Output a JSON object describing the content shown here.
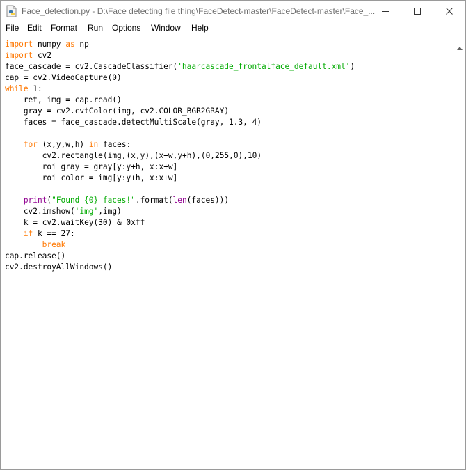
{
  "window": {
    "title": "Face_detection.py - D:\\Face detecting file thing\\FaceDetect-master\\FaceDetect-master\\Face_...",
    "app_icon": "python-file-icon",
    "controls": {
      "minimize": "minimize-icon",
      "maximize": "maximize-icon",
      "close": "close-icon"
    }
  },
  "menubar": {
    "items": [
      "File",
      "Edit",
      "Format",
      "Run",
      "Options",
      "Window",
      "Help"
    ]
  },
  "editor": {
    "language": "python",
    "colors": {
      "keyword": "#ff7700",
      "builtin": "#900090",
      "string": "#00aa00",
      "default": "#000000"
    },
    "lines": [
      "import numpy as np",
      "import cv2",
      "face_cascade = cv2.CascadeClassifier('haarcascade_frontalface_default.xml')",
      "cap = cv2.VideoCapture(0)",
      "while 1:",
      "    ret, img = cap.read()",
      "    gray = cv2.cvtColor(img, cv2.COLOR_BGR2GRAY)",
      "    faces = face_cascade.detectMultiScale(gray, 1.3, 4)",
      "",
      "    for (x,y,w,h) in faces:",
      "        cv2.rectangle(img,(x,y),(x+w,y+h),(0,255,0),10)",
      "        roi_gray = gray[y:y+h, x:x+w]",
      "        roi_color = img[y:y+h, x:x+w]",
      "",
      "    print(\"Found {0} faces!\".format(len(faces)))",
      "    cv2.imshow('img',img)",
      "    k = cv2.waitKey(30) & 0xff",
      "    if k == 27:",
      "        break",
      "cap.release()",
      "cv2.destroyAllWindows()"
    ]
  },
  "scrollbar": {
    "up_icon": "scroll-up-arrow-icon",
    "down_icon": "scroll-down-arrow-icon"
  }
}
